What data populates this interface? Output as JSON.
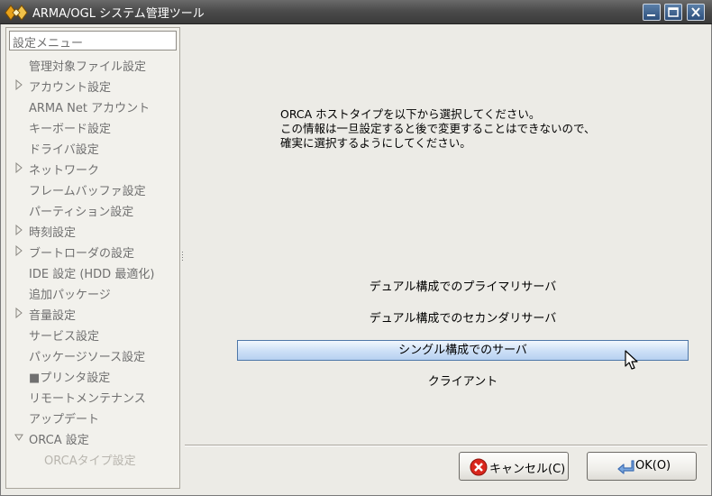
{
  "window": {
    "title": "ARMA/OGL システム管理ツール"
  },
  "sidebar": {
    "header": "設定メニュー",
    "items": [
      {
        "label": "管理対象ファイル設定",
        "expander": "none"
      },
      {
        "label": "アカウント設定",
        "expander": "collapsed"
      },
      {
        "label": "ARMA Net アカウント",
        "expander": "none"
      },
      {
        "label": "キーボード設定",
        "expander": "none"
      },
      {
        "label": "ドライバ設定",
        "expander": "none"
      },
      {
        "label": "ネットワーク",
        "expander": "collapsed"
      },
      {
        "label": "フレームバッファ設定",
        "expander": "none"
      },
      {
        "label": "パーティション設定",
        "expander": "none"
      },
      {
        "label": "時刻設定",
        "expander": "collapsed"
      },
      {
        "label": "ブートローダの設定",
        "expander": "collapsed"
      },
      {
        "label": "IDE 設定 (HDD 最適化)",
        "expander": "none"
      },
      {
        "label": "追加パッケージ",
        "expander": "none"
      },
      {
        "label": "音量設定",
        "expander": "collapsed"
      },
      {
        "label": "サービス設定",
        "expander": "none"
      },
      {
        "label": "パッケージソース設定",
        "expander": "none"
      },
      {
        "label": "■プリンタ設定",
        "expander": "none"
      },
      {
        "label": "リモートメンテナンス",
        "expander": "none"
      },
      {
        "label": "アップデート",
        "expander": "none"
      },
      {
        "label": "ORCA 設定",
        "expander": "expanded"
      }
    ],
    "child_item": {
      "label": "ORCAタイプ設定"
    }
  },
  "main": {
    "description": [
      "ORCA ホストタイプを以下から選択してください。",
      "この情報は一旦設定すると後で変更することはできないので、",
      "確実に選択するようにしてください。"
    ],
    "options": [
      {
        "label": "デュアル構成でのプライマリサーバ",
        "selected": false
      },
      {
        "label": "デュアル構成でのセカンダリサーバ",
        "selected": false
      },
      {
        "label": "シングル構成でのサーバ",
        "selected": true
      },
      {
        "label": "クライアント",
        "selected": false
      }
    ]
  },
  "buttons": {
    "cancel_label": "キャンセル(C)",
    "ok_label": "OK(O)"
  },
  "colors": {
    "titlebar": "#4c4c4c",
    "selection": "#cfe1f7",
    "selection_border": "#4e77a8",
    "cancel_icon": "#d9261c",
    "ok_icon": "#3f6fb5"
  }
}
